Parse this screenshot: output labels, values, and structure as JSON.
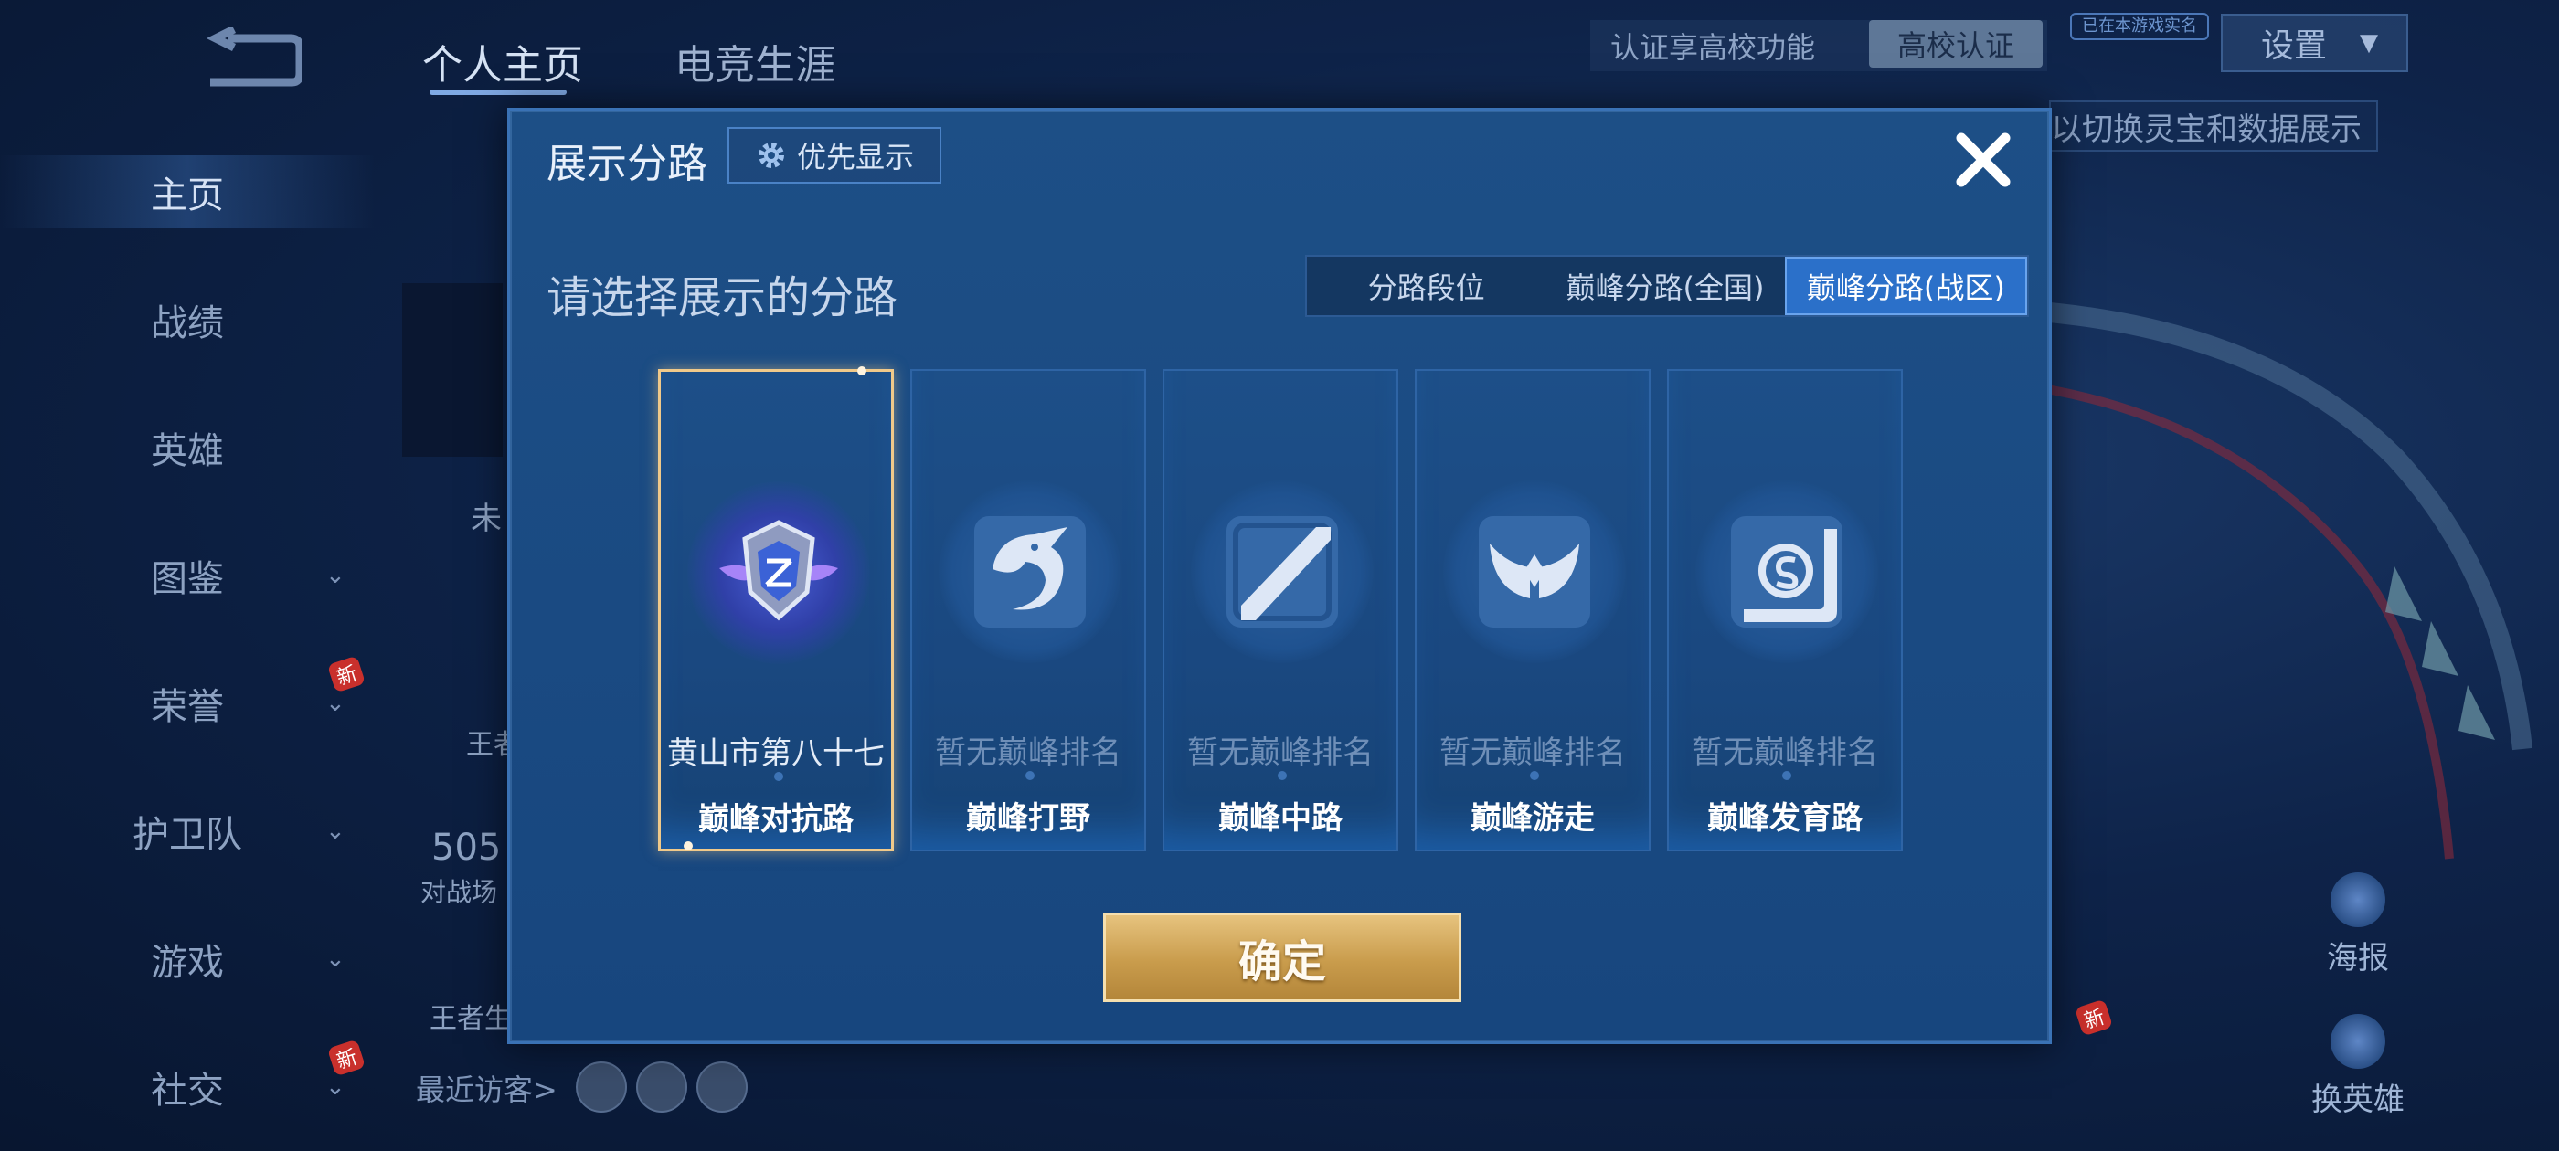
{
  "header": {
    "tabs": [
      {
        "label": "个人主页"
      },
      {
        "label": "电竞生涯"
      }
    ],
    "cert_text": "认证享高校功能",
    "campus_chip": "高校认证",
    "verified_chip": "已在本游戏实名",
    "settings_label": "设置",
    "hint_text": "以切换灵宝和数据展示"
  },
  "sidebar": {
    "items": [
      {
        "label": "主页"
      },
      {
        "label": "战绩"
      },
      {
        "label": "英雄"
      },
      {
        "label": "图鉴"
      },
      {
        "label": "荣誉",
        "badge": "新"
      },
      {
        "label": "护卫队"
      },
      {
        "label": "游戏"
      },
      {
        "label": "社交",
        "badge": "新"
      }
    ]
  },
  "background": {
    "not_text": "未",
    "king_text": "王者",
    "count_text": "505",
    "battle_text": "对战场",
    "king_life_text": "王者生",
    "visitors_label": "最近访客>",
    "poster_label": "海报",
    "switch_hero_label": "换英雄",
    "new_badge": "新"
  },
  "modal": {
    "title": "展示分路",
    "priority_label": "优先显示",
    "subtitle": "请选择展示的分路",
    "filter_tabs": [
      {
        "label": "分路段位"
      },
      {
        "label": "巅峰分路(全国)"
      },
      {
        "label": "巅峰分路(战区)"
      }
    ],
    "lanes": [
      {
        "rank": "黄山市第八十七",
        "name": "巅峰对抗路",
        "icon": "shield-emblem-icon",
        "selected": true
      },
      {
        "rank": "暂无巅峰排名",
        "name": "巅峰打野",
        "icon": "dragon-icon",
        "selected": false
      },
      {
        "rank": "暂无巅峰排名",
        "name": "巅峰中路",
        "icon": "slash-icon",
        "selected": false
      },
      {
        "rank": "暂无巅峰排名",
        "name": "巅峰游走",
        "icon": "wings-icon",
        "selected": false
      },
      {
        "rank": "暂无巅峰排名",
        "name": "巅峰发育路",
        "icon": "target-icon",
        "selected": false
      }
    ],
    "confirm_label": "确定"
  },
  "colors": {
    "modal_bg": "#1d4f86",
    "active_tab": "#2b70c9",
    "selected_border": "#f0c98a",
    "confirm_gold": "#c99c4c"
  }
}
